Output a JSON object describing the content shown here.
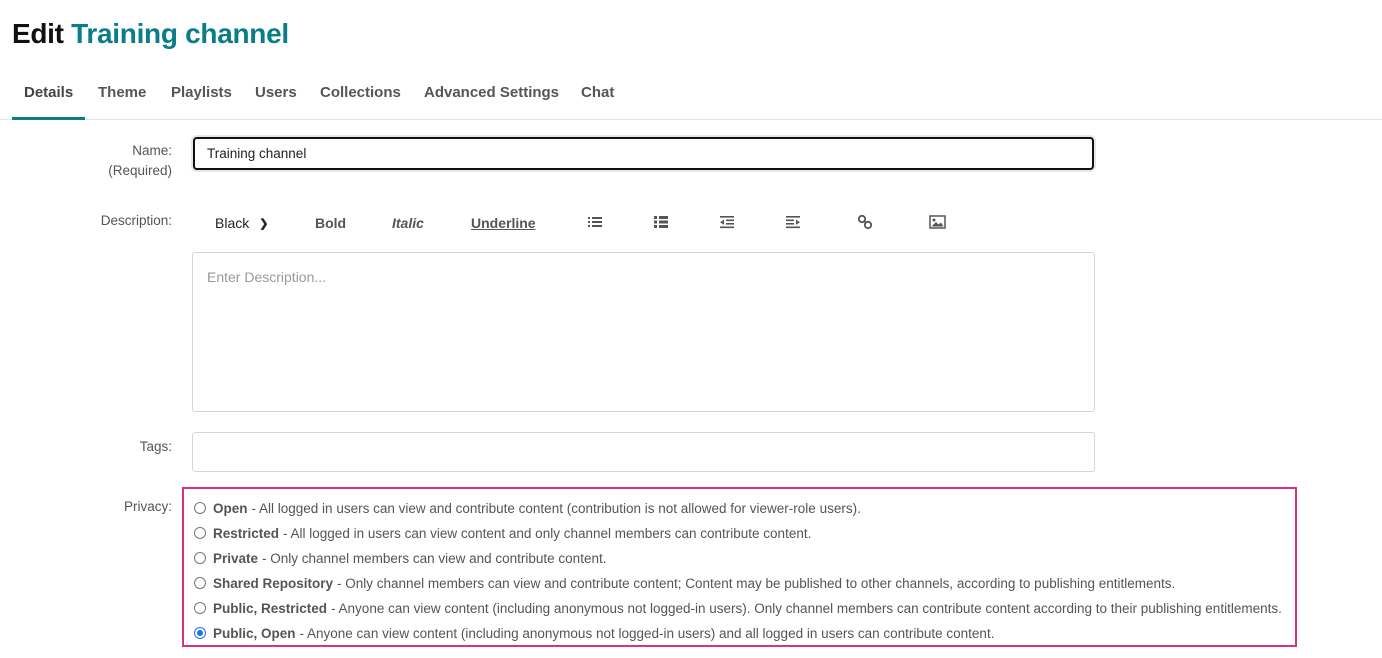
{
  "header": {
    "prefix": "Edit",
    "channel_name": "Training channel"
  },
  "tabs": [
    {
      "label": "Details",
      "active": true
    },
    {
      "label": "Theme"
    },
    {
      "label": "Playlists"
    },
    {
      "label": "Users"
    },
    {
      "label": "Collections"
    },
    {
      "label": "Advanced Settings"
    },
    {
      "label": "Chat"
    }
  ],
  "form": {
    "name_label": "Name:",
    "name_required": "(Required)",
    "name_value": "Training channel",
    "description_label": "Description:",
    "description_placeholder": "Enter Description...",
    "tags_label": "Tags:",
    "privacy_label": "Privacy:"
  },
  "toolbar": {
    "color": "Black",
    "bold": "Bold",
    "italic": "Italic",
    "underline": "Underline",
    "icons": [
      "bullet-list-icon",
      "numbered-list-icon",
      "outdent-icon",
      "indent-icon",
      "link-icon",
      "image-icon"
    ]
  },
  "privacy_options": [
    {
      "title": "Open",
      "desc": "- All logged in users can view and contribute content (contribution is not allowed for viewer-role users).",
      "selected": false
    },
    {
      "title": "Restricted",
      "desc": "- All logged in users can view content and only channel members can contribute content.",
      "selected": false
    },
    {
      "title": "Private",
      "desc": "- Only channel members can view and contribute content.",
      "selected": false
    },
    {
      "title": "Shared Repository",
      "desc": "- Only channel members can view and contribute content; Content may be published to other channels, according to publishing entitlements.",
      "selected": false
    },
    {
      "title": "Public, Restricted",
      "desc": "- Anyone can view content (including anonymous not logged-in users). Only channel members can contribute content according to their publishing entitlements.",
      "selected": false
    },
    {
      "title": "Public, Open",
      "desc": "- Anyone can view content (including anonymous not logged-in users) and all logged in users can contribute content.",
      "selected": true
    }
  ],
  "colors": {
    "accent": "#0b7c8a",
    "highlight_border": "#d63384",
    "radio_selected": "#1a73e8"
  }
}
